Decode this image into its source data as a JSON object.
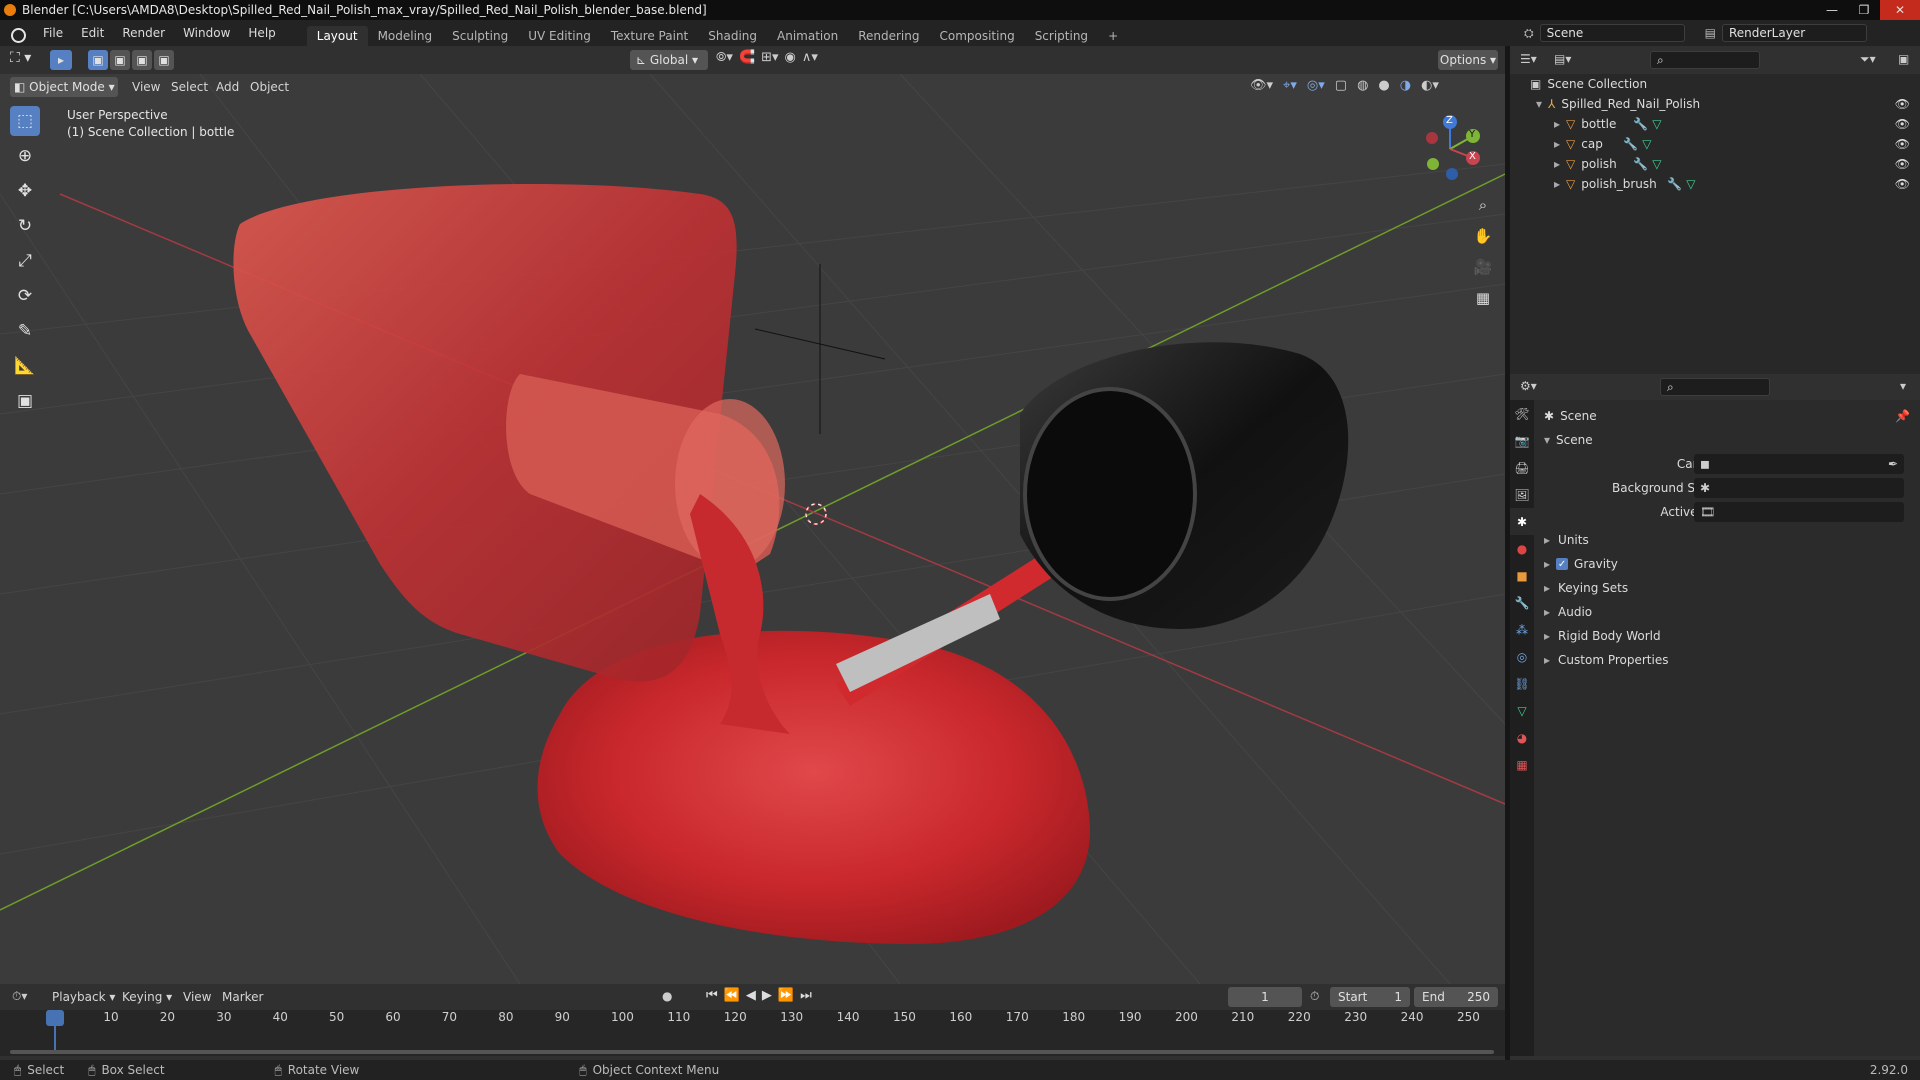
{
  "window": {
    "title": "Blender [C:\\Users\\AMDA8\\Desktop\\Spilled_Red_Nail_Polish_max_vray/Spilled_Red_Nail_Polish_blender_base.blend]",
    "controls": [
      "—",
      "❐",
      "✕"
    ]
  },
  "menu": [
    "File",
    "Edit",
    "Render",
    "Window",
    "Help"
  ],
  "workspaces": [
    "Layout",
    "Modeling",
    "Sculpting",
    "UV Editing",
    "Texture Paint",
    "Shading",
    "Animation",
    "Rendering",
    "Compositing",
    "Scripting"
  ],
  "add_workspace": "+",
  "scene_name": "Scene",
  "renderlayer_name": "RenderLayer",
  "viewport_header": {
    "mode": "Object Mode",
    "menus": [
      "View",
      "Select",
      "Add",
      "Object"
    ],
    "transform_orientation": "Global",
    "options": "Options"
  },
  "viewport_overlay": {
    "line1": "User Perspective",
    "line2": "(1) Scene Collection | bottle"
  },
  "gizmo_axes": {
    "x": "X",
    "y": "Y",
    "z": "Z"
  },
  "outliner": {
    "root": "Scene Collection",
    "collection": "Spilled_Red_Nail_Polish",
    "objects": [
      "bottle",
      "cap",
      "polish",
      "polish_brush"
    ]
  },
  "properties": {
    "context": "Scene",
    "panel": "Scene",
    "fields": [
      {
        "label": "Camera",
        "value": ""
      },
      {
        "label": "Background Scene",
        "value": ""
      },
      {
        "label": "Active Clip",
        "value": ""
      }
    ],
    "subpanels": [
      "Units",
      "Gravity",
      "Keying Sets",
      "Audio",
      "Rigid Body World",
      "Custom Properties"
    ],
    "gravity_enabled": true
  },
  "timeline": {
    "menus": [
      "Playback",
      "Keying",
      "View",
      "Marker"
    ],
    "current_frame": "1",
    "start_label": "Start",
    "start": "1",
    "end_label": "End",
    "end": "250",
    "ticks": [
      "1",
      "10",
      "20",
      "30",
      "40",
      "50",
      "60",
      "70",
      "80",
      "90",
      "100",
      "110",
      "120",
      "130",
      "140",
      "150",
      "160",
      "170",
      "180",
      "190",
      "200",
      "210",
      "220",
      "230",
      "240",
      "250"
    ]
  },
  "statusbar": {
    "items": [
      "Select",
      "Box Select",
      "Rotate View",
      "Object Context Menu"
    ],
    "version": "2.92.0"
  },
  "colors": {
    "accent": "#5680c2",
    "blender_orange": "#e87d0d",
    "polish_red": "#c8262a",
    "axis_x": "#c84451",
    "axis_y": "#7fb536",
    "axis_z": "#3f7ad8"
  }
}
